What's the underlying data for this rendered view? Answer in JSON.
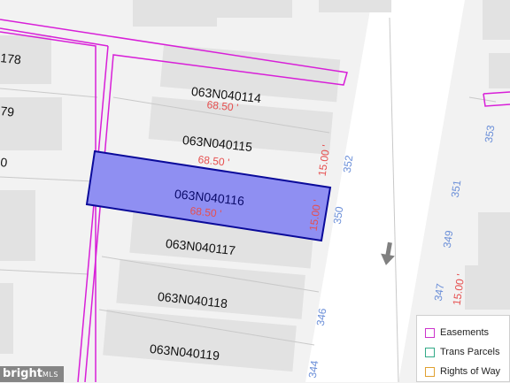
{
  "parcels": [
    {
      "id": "063N040114",
      "dim": "68.50 '"
    },
    {
      "id": "063N040115",
      "dim": "68.50 '",
      "frontage": "15.00 '"
    },
    {
      "id": "063N040116",
      "dim": "68.50 '",
      "frontage": "15.00 '",
      "selected": true
    },
    {
      "id": "063N040117"
    },
    {
      "id": "063N040118"
    },
    {
      "id": "063N040119"
    }
  ],
  "left_parcel_labels": [
    "178",
    "79",
    "0"
  ],
  "address_numbers": {
    "west_side": [
      "352",
      "350",
      "346",
      "344"
    ],
    "east_side": [
      "353",
      "351",
      "349",
      "347"
    ]
  },
  "east_frontage": "15.00 '",
  "legend": {
    "items": [
      {
        "label": "Easements",
        "color": "#cc33cc"
      },
      {
        "label": "Trans Parcels",
        "color": "#33aa88"
      },
      {
        "label": "Rights of Way",
        "color": "#e0a030"
      }
    ]
  },
  "watermark": {
    "brand": "bright",
    "sub": "MLS"
  },
  "colors": {
    "selected_fill": "#8f8ff2",
    "selected_stroke": "#0a0a9a",
    "easement": "#d81fd8",
    "dimension": "#e65050",
    "address": "#6b8fd8"
  },
  "icons": {
    "north_arrow": "down-arrow-icon"
  }
}
